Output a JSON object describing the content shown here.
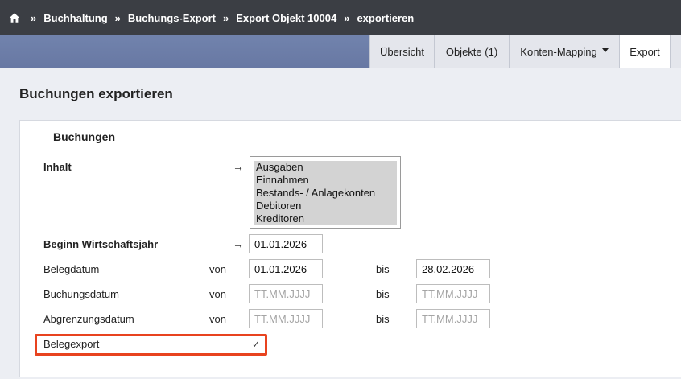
{
  "breadcrumb": {
    "separator": "»",
    "items": [
      "Buchhaltung",
      "Buchungs-Export",
      "Export Objekt 10004",
      "exportieren"
    ]
  },
  "tabs": {
    "overview": "Übersicht",
    "objects": "Objekte (1)",
    "mapping": "Konten-Mapping",
    "export": "Export"
  },
  "page": {
    "title": "Buchungen exportieren"
  },
  "section": {
    "legend": "Buchungen"
  },
  "form": {
    "arrow": "→",
    "content": {
      "label": "Inhalt",
      "options": [
        "Ausgaben",
        "Einnahmen",
        "Bestands- / Anlagekonten",
        "Debitoren",
        "Kreditoren"
      ]
    },
    "fiscal_start": {
      "label": "Beginn Wirtschaftsjahr",
      "value": "01.01.2026"
    },
    "from_label": "von",
    "to_label": "bis",
    "belegdatum": {
      "label": "Belegdatum",
      "from": "01.01.2026",
      "to": "28.02.2026"
    },
    "buchungsdatum": {
      "label": "Buchungsdatum",
      "from_placeholder": "TT.MM.JJJJ",
      "to_placeholder": "TT.MM.JJJJ"
    },
    "abgrenzungsdatum": {
      "label": "Abgrenzungsdatum",
      "from_placeholder": "TT.MM.JJJJ",
      "to_placeholder": "TT.MM.JJJJ"
    },
    "belegexport": {
      "label": "Belegexport",
      "checkmark": "✓"
    }
  },
  "colors": {
    "topbar": "#3b3e44",
    "tabband": "#6f81aa",
    "highlight": "#e8431f"
  }
}
